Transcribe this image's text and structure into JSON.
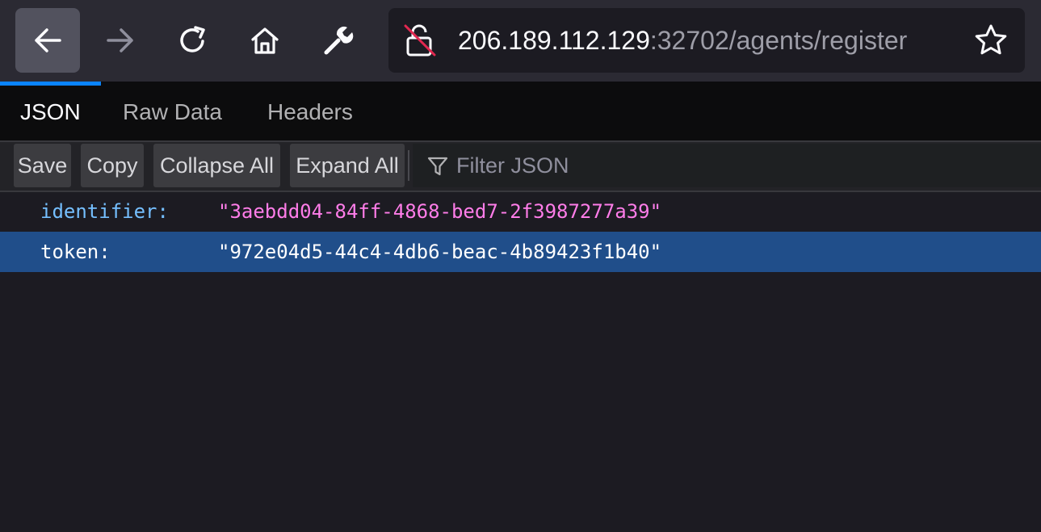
{
  "browser": {
    "url_host": "206.189.112.129",
    "url_path": ":32702/agents/register",
    "icons": {
      "back": "back-arrow-icon",
      "forward": "forward-arrow-icon",
      "reload": "reload-icon",
      "home": "home-icon",
      "tools": "wrench-icon",
      "security": "insecure-lock-icon",
      "bookmark": "star-icon"
    }
  },
  "viewer": {
    "tabs": [
      "JSON",
      "Raw Data",
      "Headers"
    ],
    "selected_tab": "JSON",
    "actions": {
      "save": "Save",
      "copy": "Copy",
      "collapse_all": "Collapse All",
      "expand_all": "Expand All"
    },
    "filter_placeholder": "Filter JSON",
    "rows": [
      {
        "key": "identifier:",
        "value": "\"3aebdd04-84ff-4868-bed7-2f3987277a39\""
      },
      {
        "key": "token:",
        "value": "\"972e04d5-44c4-4db6-beac-4b89423f1b40\""
      }
    ]
  },
  "colors": {
    "accent": "#0a84ff",
    "selected_row": "#204e8a",
    "json_key": "#75bfff",
    "json_string": "#ff7de9"
  }
}
